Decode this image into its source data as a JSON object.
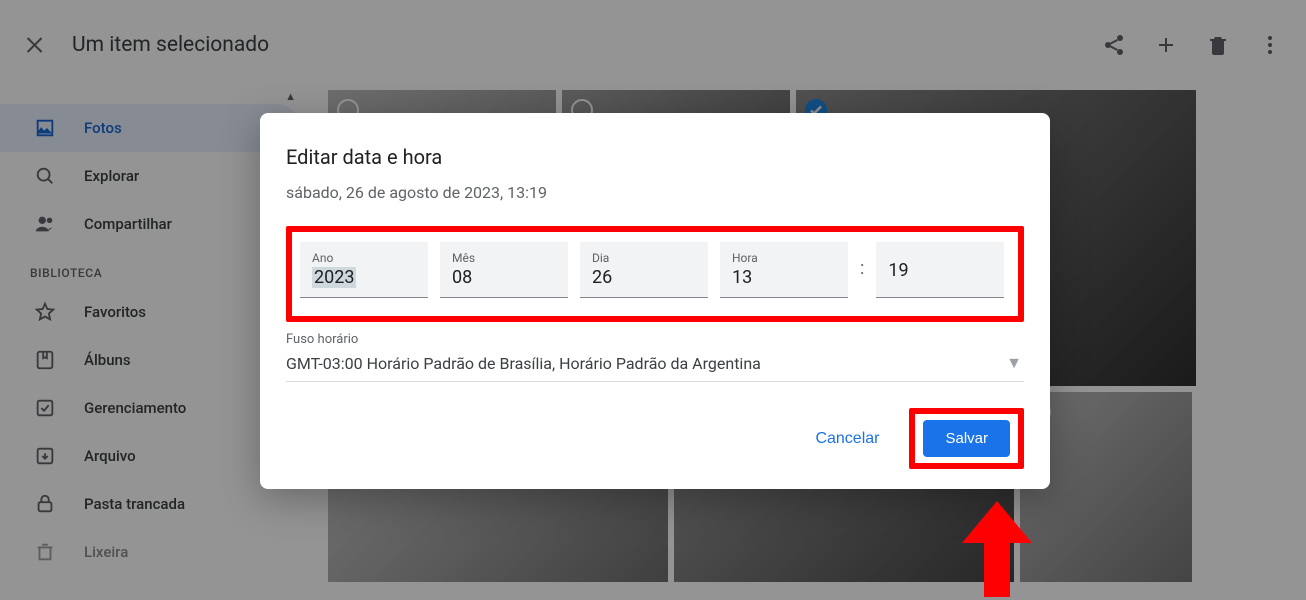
{
  "topbar": {
    "title": "Um item selecionado"
  },
  "sidebar": {
    "items": [
      {
        "label": "Fotos"
      },
      {
        "label": "Explorar"
      },
      {
        "label": "Compartilhar"
      }
    ],
    "section_label": "BIBLIOTECA",
    "library": [
      {
        "label": "Favoritos"
      },
      {
        "label": "Álbuns"
      },
      {
        "label": "Gerenciamento"
      },
      {
        "label": "Arquivo"
      },
      {
        "label": "Pasta trancada"
      },
      {
        "label": "Lixeira"
      }
    ]
  },
  "dialog": {
    "title": "Editar data e hora",
    "subtitle": "sábado, 26 de agosto de 2023, 13:19",
    "fields": {
      "year": {
        "label": "Ano",
        "value": "2023"
      },
      "month": {
        "label": "Mês",
        "value": "08"
      },
      "day": {
        "label": "Dia",
        "value": "26"
      },
      "hour": {
        "label": "Hora",
        "value": "13"
      },
      "minute": {
        "label": " ",
        "value": "19"
      }
    },
    "colon": ":",
    "timezone_label": "Fuso horário",
    "timezone_value": "GMT-03:00 Horário Padrão de Brasília, Horário Padrão da Argentina",
    "cancel": "Cancelar",
    "save": "Salvar"
  }
}
